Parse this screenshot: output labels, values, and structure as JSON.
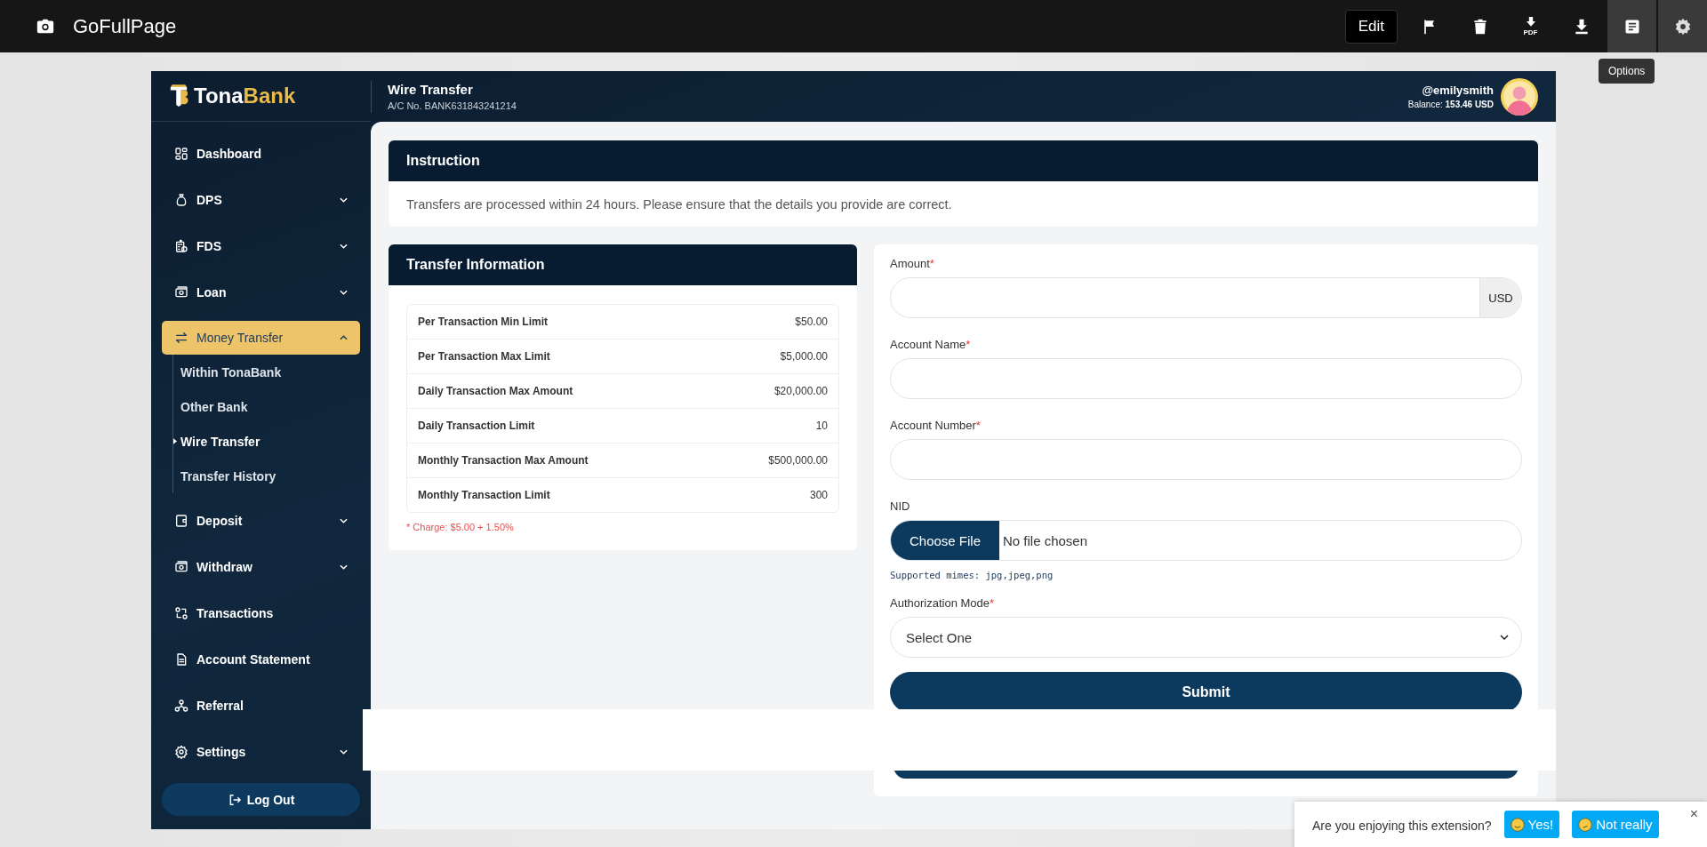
{
  "extension_bar": {
    "title": "GoFullPage",
    "edit": "Edit",
    "tools": [
      {
        "kind": "flag",
        "active": false
      },
      {
        "kind": "trash",
        "active": false
      },
      {
        "kind": "pdf",
        "label": "PDF",
        "active": false
      },
      {
        "kind": "download",
        "active": false
      },
      {
        "kind": "page",
        "active": true
      },
      {
        "kind": "settings",
        "active": true
      }
    ],
    "tooltip": "Options"
  },
  "header": {
    "logo_first": "Tona",
    "logo_second": "Bank",
    "title": "Wire Transfer",
    "account_no": "A/C No. BANK631843241214",
    "username": "@emilysmith",
    "balance_label": "Balance:",
    "balance_value": "153.46 USD"
  },
  "sidebar": {
    "items": [
      {
        "label": "Dashboard",
        "selected": false
      },
      {
        "label": "DPS",
        "expanded": false,
        "selected": false
      },
      {
        "label": "FDS",
        "expanded": false,
        "selected": false
      },
      {
        "label": "Loan",
        "expanded": false,
        "selected": false
      },
      {
        "label": "Money Transfer",
        "expanded": true,
        "selected": true,
        "children": [
          {
            "label": "Within TonaBank",
            "selected": false
          },
          {
            "label": "Other Bank",
            "selected": false
          },
          {
            "label": "Wire Transfer",
            "selected": true
          },
          {
            "label": "Transfer History",
            "selected": false
          }
        ]
      },
      {
        "label": "Deposit",
        "expanded": false,
        "selected": false
      },
      {
        "label": "Withdraw",
        "expanded": false,
        "selected": false
      },
      {
        "label": "Transactions",
        "selected": false
      },
      {
        "label": "Account Statement",
        "selected": false
      },
      {
        "label": "Referral",
        "selected": false
      },
      {
        "label": "Settings",
        "expanded": false,
        "selected": false
      }
    ],
    "logout": "Log Out"
  },
  "instruction": {
    "title": "Instruction",
    "text": "Transfers are processed within 24 hours. Please ensure that the details you provide are correct."
  },
  "transfer_info": {
    "title": "Transfer Information",
    "rows": [
      {
        "label": "Per Transaction Min Limit",
        "value": "$50.00"
      },
      {
        "label": "Per Transaction Max Limit",
        "value": "$5,000.00"
      },
      {
        "label": "Daily Transaction Max Amount",
        "value": "$20,000.00"
      },
      {
        "label": "Daily Transaction Limit",
        "value": "10"
      },
      {
        "label": "Monthly Transaction Max Amount",
        "value": "$500,000.00"
      },
      {
        "label": "Monthly Transaction Limit",
        "value": "300"
      }
    ],
    "charge": "* Charge: $5.00 + 1.50%"
  },
  "form": {
    "fields": [
      {
        "kind": "text",
        "label": "Amount",
        "required_mark": "*",
        "suffix": "USD"
      },
      {
        "kind": "text",
        "label": "Account Name",
        "required_mark": "*"
      },
      {
        "kind": "text",
        "label": "Account Number",
        "required_mark": "*"
      },
      {
        "kind": "file",
        "label": "NID",
        "button": "Choose File",
        "status": "No file chosen",
        "hint": "Supported mimes: jpg,jpeg,png"
      },
      {
        "kind": "select",
        "label": "Authorization Mode",
        "required_mark": "*",
        "value": "Select One"
      }
    ],
    "submit": "Submit"
  },
  "feedback": {
    "question": "Are you enjoying this extension?",
    "yes": "Yes!",
    "no": "Not really",
    "close": "×"
  }
}
